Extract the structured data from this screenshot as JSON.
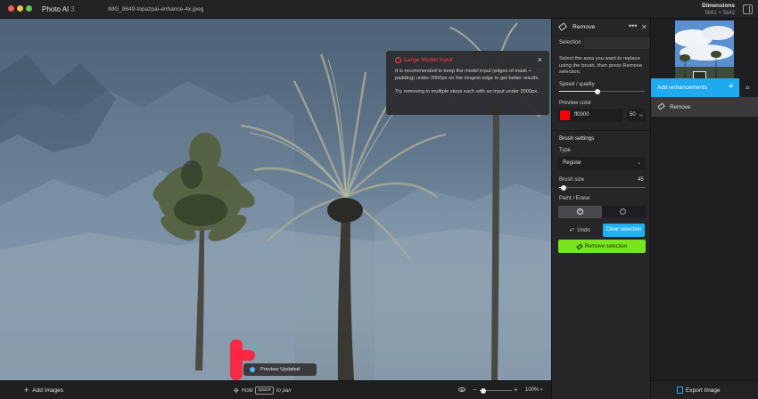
{
  "app": {
    "name": "Photo AI",
    "version": "3",
    "file_name": "IMG_8649-topazpai-enhance-4x.jpeg"
  },
  "dimensions": {
    "title": "Dimensions",
    "value": "5661 × 5642"
  },
  "popup": {
    "title": "Large Model Input",
    "paragraph1": "It is recommended to keep the model input (edges of mask + padding) under 2000px on the longest edge to get better results.",
    "paragraph2": "Try removing in multiple steps each with an input under 2000px."
  },
  "toast": {
    "text": "Preview Updated"
  },
  "bottom": {
    "add_images": "Add Images",
    "hold": "Hold",
    "key": "space",
    "to_pan": "to pan",
    "zoom_value": "100%",
    "zoom_level": 0.1
  },
  "panel": {
    "title": "Remove",
    "selection_label": "Selection",
    "description": "Select the area you want to replace using the brush, then press Remove selection.",
    "speed_label": "Speed / quality",
    "speed_level": 0.45,
    "preview_color_label": "Preview color",
    "preview_color_hex": "ff0000",
    "preview_color": "#ff0000",
    "opacity_value": "50",
    "opacity_unit": "%",
    "brush_settings_title": "Brush settings",
    "type_label": "Type",
    "type_value": "Regular",
    "brush_size_label": "Brush size",
    "brush_size_value": "45",
    "brush_size_level": 0.05,
    "paint_erase_label": "Paint / Erase",
    "undo_label": "Undo",
    "clear_label": "Clear selection",
    "remove_label": "Remove selection"
  },
  "sidebar": {
    "add_enhancements": "Add enhancements",
    "items": [
      {
        "label": "Remove",
        "icon": "eraser-icon"
      }
    ],
    "export_label": "Export Image"
  },
  "colors": {
    "accent_blue": "#1fb2f2",
    "accent_green": "#78e51f",
    "warning_red": "#ff3a4e"
  }
}
